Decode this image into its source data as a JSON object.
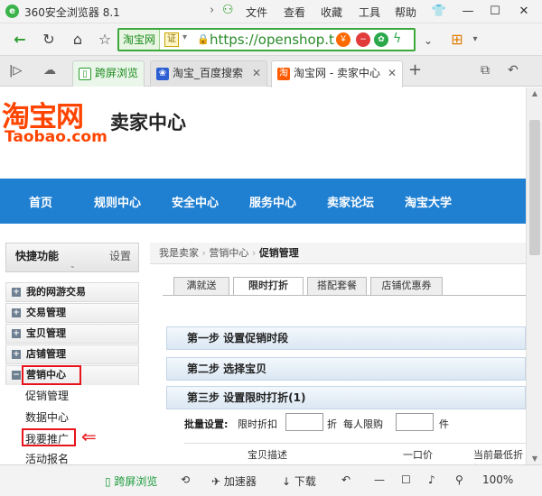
{
  "browser": {
    "title": "360安全浏览器 8.1",
    "menu": [
      "文件",
      "查看",
      "收藏",
      "工具",
      "帮助"
    ],
    "address": {
      "site_label": "淘宝网",
      "cert_label": "证",
      "url": "https://openshop.t"
    },
    "tabs": [
      {
        "label": "跨屏浏览"
      },
      {
        "label": "淘宝_百度搜索"
      },
      {
        "label": "淘宝网 - 卖家中心"
      }
    ],
    "status": {
      "crossscreen": "跨屏浏览",
      "accelerator": "加速器",
      "download": "下载",
      "zoom": "100%"
    }
  },
  "page": {
    "brand_cn": "淘宝网",
    "brand_en": "Taobao.com",
    "page_title": "卖家中心",
    "nav": [
      "首页",
      "规则中心",
      "安全中心",
      "服务中心",
      "卖家论坛",
      "淘宝大学"
    ],
    "sidebar": {
      "title": "快捷功能",
      "settings": "设置",
      "groups": [
        "我的网游交易",
        "交易管理",
        "宝贝管理",
        "店铺管理",
        "营销中心"
      ],
      "sub_items": [
        "促销管理",
        "数据中心",
        "我要推广",
        "活动报名"
      ]
    },
    "breadcrumb": [
      "我是卖家",
      "营销中心",
      "促销管理"
    ],
    "subtabs": [
      "满就送",
      "限时打折",
      "搭配套餐",
      "店铺优惠券"
    ],
    "steps": [
      "第一步 设置促销时段",
      "第二步 选择宝贝",
      "第三步 设置限时打折(1)"
    ],
    "batch": {
      "label": "批量设置:",
      "discount_label": "限时折扣",
      "discount_unit": "折",
      "limit_label": "每人限购",
      "limit_unit": "件"
    },
    "table_headers": [
      "宝贝描述",
      "一口价",
      "当前最低折扣"
    ]
  },
  "colors": {
    "brand_orange": "#ff4400",
    "nav_blue": "#1f7fd1",
    "highlight_red": "#e8141b",
    "address_green": "#3aa93a"
  }
}
